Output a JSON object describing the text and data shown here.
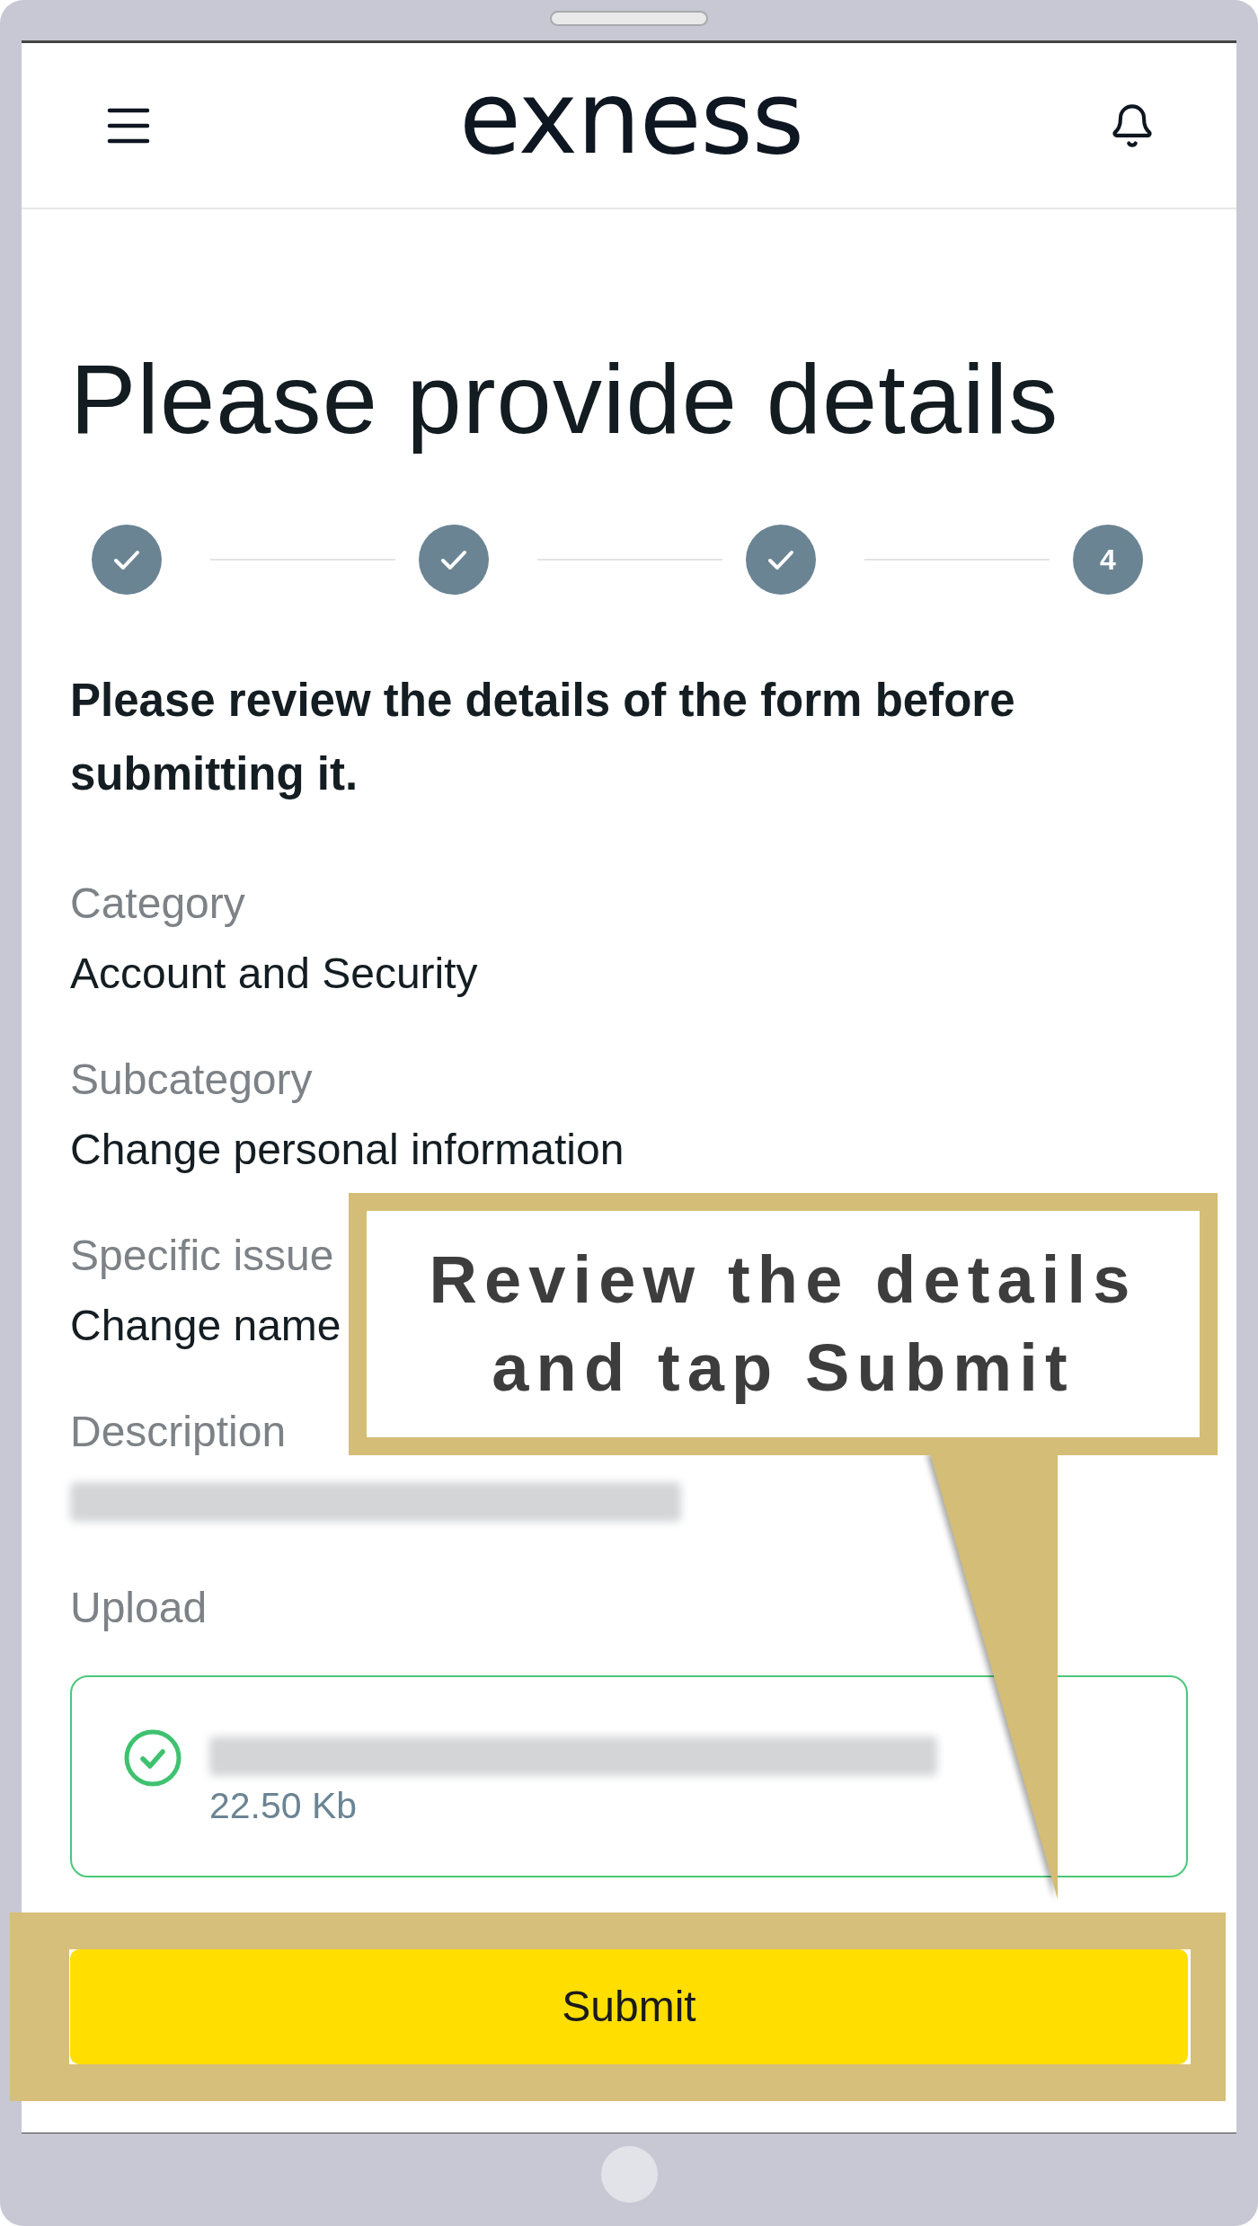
{
  "header": {
    "logo": "exness"
  },
  "title": "Please provide details",
  "steps": [
    {
      "completed": true
    },
    {
      "completed": true
    },
    {
      "completed": true
    },
    {
      "completed": false,
      "number": "4"
    }
  ],
  "instructions": "Please review the details of the form before submitting it.",
  "details": [
    {
      "kind": "text",
      "label": "Category",
      "value": "Account and Security"
    },
    {
      "kind": "text",
      "label": "Subcategory",
      "value": "Change personal information"
    },
    {
      "kind": "text",
      "label": "Specific issue",
      "value": "Change name"
    },
    {
      "kind": "blurred",
      "label": "Description"
    }
  ],
  "upload": {
    "label": "Upload",
    "uploaded": true,
    "file_size": "22.50 Kb"
  },
  "submit_button": {
    "label": "Submit"
  },
  "callout": {
    "text": "Review the details\nand tap Submit"
  }
}
